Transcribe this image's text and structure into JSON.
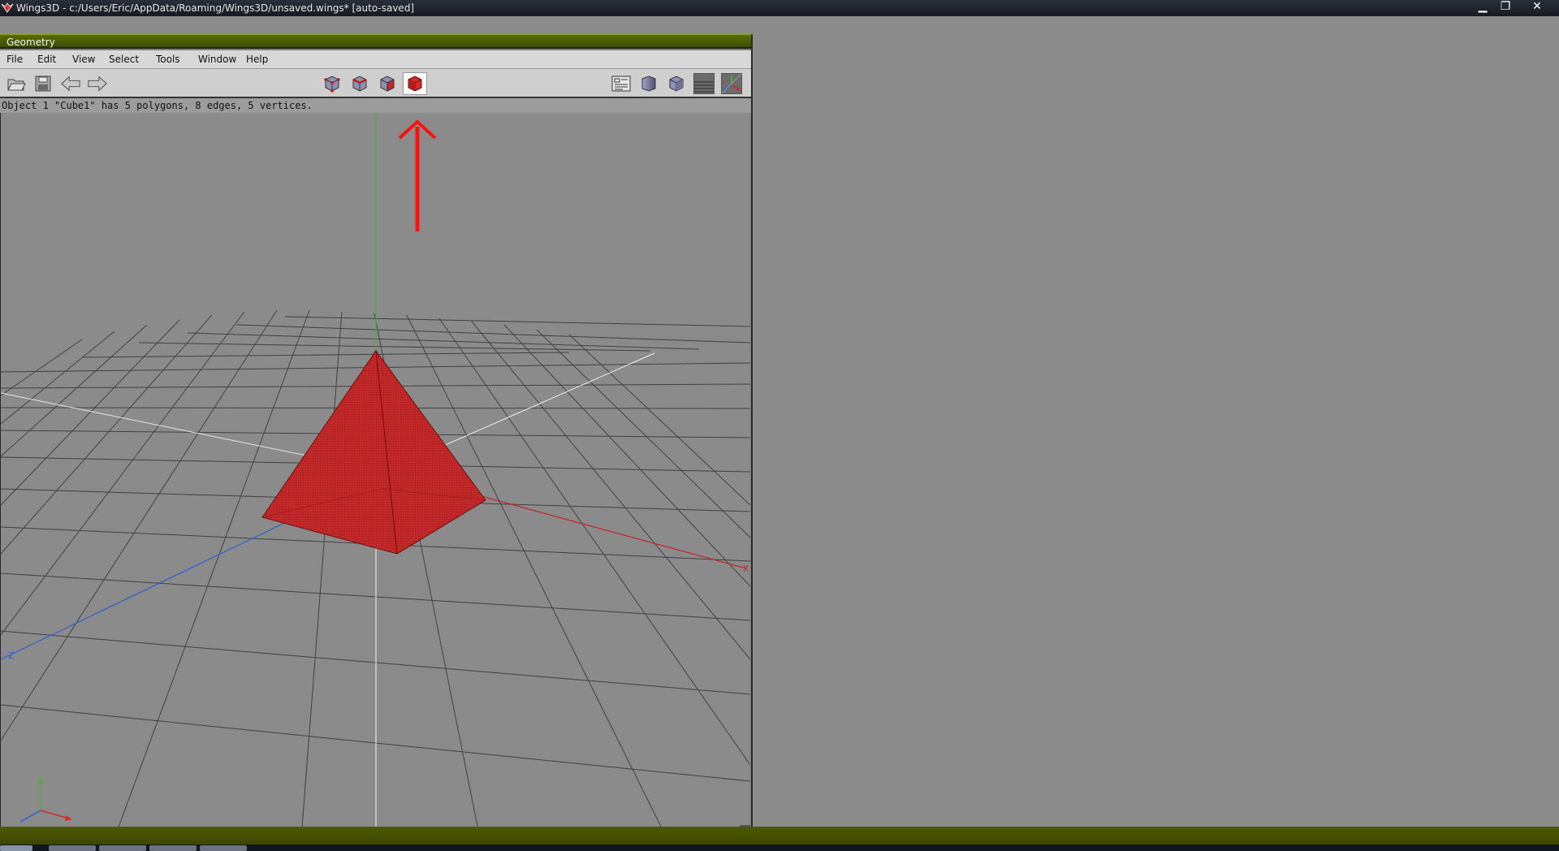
{
  "os_window": {
    "title": "Wings3D - c:/Users/Eric/AppData/Roaming/Wings3D/unsaved.wings* [auto-saved]",
    "minimize_label": "▁",
    "restore_label": "❐",
    "close_label": "✕"
  },
  "geometry_window": {
    "title": "Geometry"
  },
  "menubar": {
    "items": [
      {
        "label": "File"
      },
      {
        "label": "Edit"
      },
      {
        "label": "View"
      },
      {
        "label": "Select"
      },
      {
        "label": "Tools"
      },
      {
        "label": "Window"
      },
      {
        "label": "Help"
      }
    ]
  },
  "toolbar": {
    "left_buttons": [
      "open-icon",
      "save-icon",
      "undo-arrow-icon",
      "redo-arrow-icon"
    ],
    "select_mode_buttons": [
      "vertex-mode-icon",
      "edge-mode-icon",
      "face-mode-icon",
      "body-mode-icon"
    ],
    "active_mode": "body-mode-icon",
    "right_buttons": [
      "info-panel-icon",
      "smooth-shaded-icon",
      "flat-cube-icon",
      "groundplane-icon",
      "axes-icon"
    ]
  },
  "status": {
    "info_text": "Object 1 \"Cube1\" has 5 polygons, 8 edges, 5 vertices."
  },
  "viewport": {
    "axis_x_label": "X",
    "axis_z_label": "Z",
    "object_color": "#c0262a",
    "axis_x_color": "#c8202a",
    "axis_y_color": "#4fae38",
    "axis_z_color": "#2f5fd0"
  },
  "annotation": {
    "arrow_color": "#ff1010"
  }
}
